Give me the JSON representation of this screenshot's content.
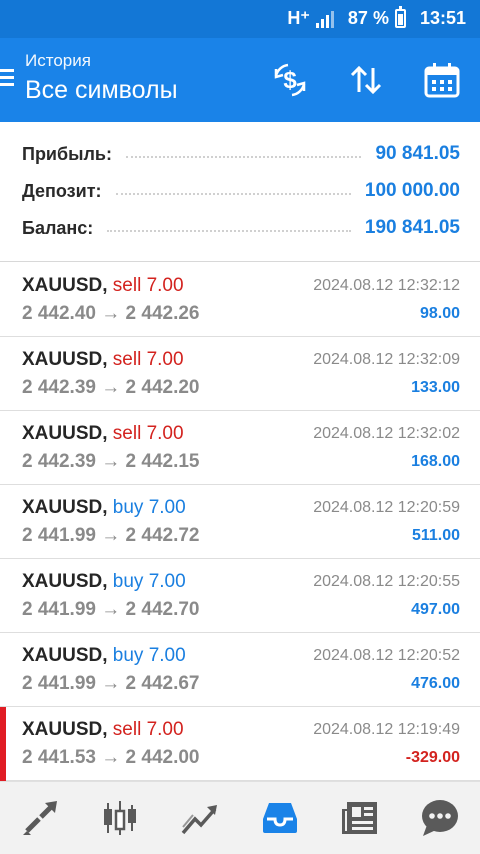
{
  "status_bar": {
    "network": "H⁺",
    "battery": "87 %",
    "time": "13:51",
    "icons": [
      "signal-icon",
      "battery-charging-icon"
    ]
  },
  "app_bar": {
    "subtitle": "История",
    "title": "Все символы",
    "icons": [
      "menu-icon",
      "currency-exchange-icon",
      "sort-icon",
      "calendar-icon"
    ],
    "color": "#1a83e8"
  },
  "summary": {
    "rows": [
      {
        "label": "Прибыль:",
        "value": "90 841.05"
      },
      {
        "label": "Депозит:",
        "value": "100 000.00"
      },
      {
        "label": "Баланс:",
        "value": "190 841.05"
      }
    ]
  },
  "deals": [
    {
      "symbol": "XAUUSD,",
      "type": "sell 7.00",
      "side": "sell",
      "open": "2 442.40",
      "arrow": "→",
      "close": "2 442.26",
      "time": "2024.08.12 12:32:12",
      "profit": "98.00"
    },
    {
      "symbol": "XAUUSD,",
      "type": "sell 7.00",
      "side": "sell",
      "open": "2 442.39",
      "arrow": "→",
      "close": "2 442.20",
      "time": "2024.08.12 12:32:09",
      "profit": "133.00"
    },
    {
      "symbol": "XAUUSD,",
      "type": "sell 7.00",
      "side": "sell",
      "open": "2 442.39",
      "arrow": "→",
      "close": "2 442.15",
      "time": "2024.08.12 12:32:02",
      "profit": "168.00"
    },
    {
      "symbol": "XAUUSD,",
      "type": "buy 7.00",
      "side": "buy",
      "open": "2 441.99",
      "arrow": "→",
      "close": "2 442.72",
      "time": "2024.08.12 12:20:59",
      "profit": "511.00"
    },
    {
      "symbol": "XAUUSD,",
      "type": "buy 7.00",
      "side": "buy",
      "open": "2 441.99",
      "arrow": "→",
      "close": "2 442.70",
      "time": "2024.08.12 12:20:55",
      "profit": "497.00"
    },
    {
      "symbol": "XAUUSD,",
      "type": "buy 7.00",
      "side": "buy",
      "open": "2 441.99",
      "arrow": "→",
      "close": "2 442.67",
      "time": "2024.08.12 12:20:52",
      "profit": "476.00"
    },
    {
      "symbol": "XAUUSD,",
      "type": "sell 7.00",
      "side": "sell",
      "open": "2 441.53",
      "arrow": "→",
      "close": "2 442.00",
      "time": "2024.08.12 12:19:49",
      "profit": "-329.00"
    }
  ],
  "bottom_nav": {
    "items": [
      "quotes-icon",
      "chart-icon",
      "trade-icon",
      "history-icon",
      "news-icon",
      "chat-icon"
    ],
    "active": "history-icon"
  },
  "colors": {
    "accent": "#1a7fe0",
    "negative": "#d3231f",
    "status_bar": "#1377d6"
  }
}
